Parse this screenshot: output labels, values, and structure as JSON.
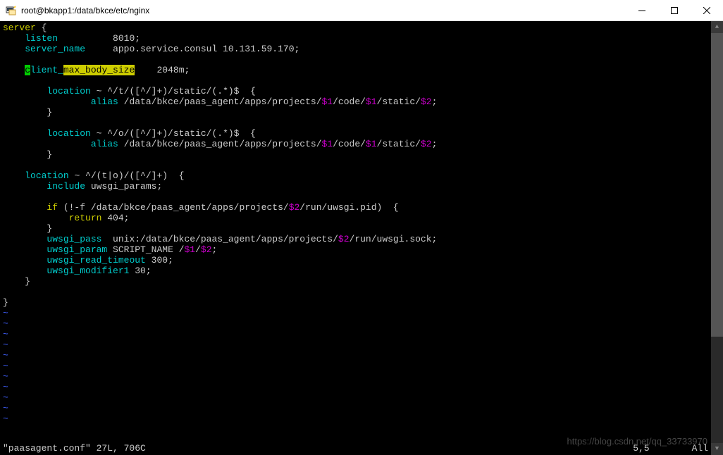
{
  "titlebar": {
    "title": "root@bkapp1:/data/bkce/etc/nginx"
  },
  "code": {
    "server_kw": "server",
    "lbrace": " {",
    "listen_kw": "listen",
    "listen_val": "8010",
    "semi": ";",
    "server_name_kw": "server_name",
    "server_name_val": "appo.service.consul 10.131.59.170",
    "cmbs_c": "c",
    "cmbs_lient": "lient_",
    "cmbs_rest": "max_body_size",
    "cmbs_val": "2048m",
    "location_kw": "location",
    "loc1_regex": " ~ ^/t/([^/]+)/static/(.*)$ ",
    "alias_kw": "alias",
    "alias_path1": " /data/bkce/paas_agent/apps/projects/",
    "d1": "$1",
    "alias_path2": "/code/",
    "alias_path3": "/static/",
    "d2": "$2",
    "loc2_regex": " ~ ^/o/([^/]+)/static/(.*)$ ",
    "loc3_regex": " ~ ^/(t|o)/([^/]+) ",
    "include_kw": "include",
    "include_val": " uwsgi_params",
    "if_kw": "if",
    "if_cond1": " (!-f /data/bkce/paas_agent/apps/projects/",
    "if_cond2": "/run/uwsgi.pid) ",
    "return_kw": "return",
    "return_val": " 404",
    "upass_kw": "uwsgi_pass",
    "upass_val1": "  unix:/data/bkce/paas_agent/apps/projects/",
    "upass_val2": "/run/uwsgi.sock",
    "uparam_kw": "uwsgi_param",
    "uparam_val1": " SCRIPT_NAME /",
    "slash": "/",
    "ureadto_kw": "uwsgi_read_timeout",
    "ureadto_val": " 300",
    "umod_kw": "uwsgi_modifier1",
    "umod_val": " 30",
    "rbrace": "}",
    "tilde": "~"
  },
  "status": {
    "left": "\"paasagent.conf\" 27L, 706C",
    "mid": "5,5",
    "right": "All"
  },
  "watermark": "https://blog.csdn.net/qq_33733970"
}
